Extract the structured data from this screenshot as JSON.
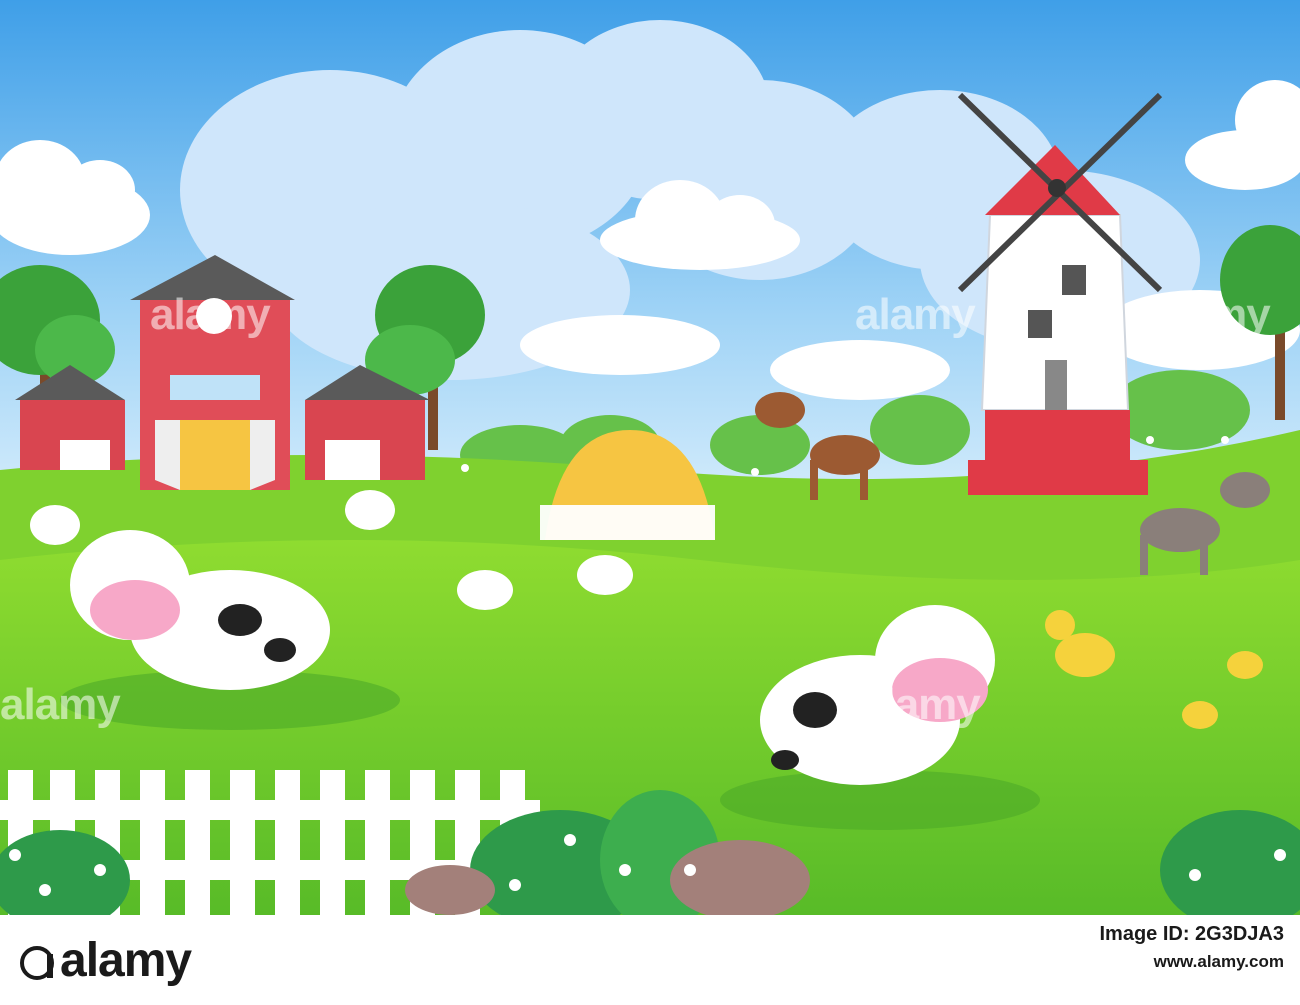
{
  "image_id": "2G3DJA3",
  "brand": "alamy",
  "image_label": "Image ID: 2G3DJA3",
  "website": "www.alamy.com",
  "watermark": "alamy",
  "colors": {
    "sky_top": "#4aa8ec",
    "sky_bottom": "#cfe9fb",
    "grass_light": "#8edb2e",
    "grass_dark": "#5fbf2a",
    "barn_red": "#d94550",
    "windmill_red": "#e03a47",
    "hay": "#f6c542"
  },
  "scene": {
    "elements": [
      "barn",
      "windmill",
      "haystack",
      "cow",
      "cow",
      "horse",
      "donkey",
      "sheep",
      "sheep",
      "sheep",
      "hen",
      "hen",
      "duck",
      "duckling",
      "duckling",
      "fence",
      "trees",
      "clouds",
      "flowers",
      "rock"
    ]
  }
}
